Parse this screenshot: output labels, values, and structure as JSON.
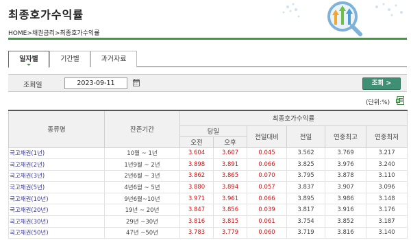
{
  "page": {
    "title": "최종호가수익률",
    "breadcrumb": [
      "HOME",
      "채권금리",
      "최종호가수익률"
    ]
  },
  "tabs": [
    {
      "label": "일자별",
      "active": true
    },
    {
      "label": "기간별",
      "active": false
    },
    {
      "label": "과거자료",
      "active": false
    }
  ],
  "search": {
    "label": "조회일",
    "date_value": "2023-09-11",
    "button_label": "조회 >"
  },
  "unit_label": "(단위:%)",
  "colors": {
    "accent_green": "#3e9a3e",
    "button_green": "#3e8f74",
    "negative_red": "#dd1111",
    "link_purple": "#3a3a9a"
  },
  "table": {
    "headers": {
      "name": "종류명",
      "maturity": "잔존기간",
      "group": "최종호가수익률",
      "today": "당일",
      "am": "오전",
      "pm": "오후",
      "change": "전일대비",
      "prev": "전일",
      "year_high": "연중최고",
      "year_low": "연중최저"
    },
    "rows": [
      {
        "name": "국고채권(1년)",
        "maturity": "10월 ~ 1년",
        "am": "3.604",
        "pm": "3.607",
        "change": "0.045",
        "prev": "3.562",
        "high": "3.769",
        "low": "3.217"
      },
      {
        "name": "국고채권(2년)",
        "maturity": "1년9월 ~ 2년",
        "am": "3.898",
        "pm": "3.891",
        "change": "0.066",
        "prev": "3.825",
        "high": "3.976",
        "low": "3.240"
      },
      {
        "name": "국고채권(3년)",
        "maturity": "2년6월 ~ 3년",
        "am": "3.862",
        "pm": "3.865",
        "change": "0.070",
        "prev": "3.795",
        "high": "3.878",
        "low": "3.110"
      },
      {
        "name": "국고채권(5년)",
        "maturity": "4년6월 ~ 5년",
        "am": "3.880",
        "pm": "3.894",
        "change": "0.057",
        "prev": "3.837",
        "high": "3.907",
        "low": "3.096"
      },
      {
        "name": "국고채권(10년)",
        "maturity": "9년6월~10년",
        "am": "3.971",
        "pm": "3.961",
        "change": "0.066",
        "prev": "3.895",
        "high": "3.986",
        "low": "3.148"
      },
      {
        "name": "국고채권(20년)",
        "maturity": "19년 ~ 20년",
        "am": "3.847",
        "pm": "3.856",
        "change": "0.039",
        "prev": "3.817",
        "high": "3.916",
        "low": "3.176"
      },
      {
        "name": "국고채권(30년)",
        "maturity": "29년 ~30년",
        "am": "3.816",
        "pm": "3.815",
        "change": "0.061",
        "prev": "3.754",
        "high": "3.852",
        "low": "3.187"
      },
      {
        "name": "국고채권(50년)",
        "maturity": "47년 ~50년",
        "am": "3.783",
        "pm": "3.779",
        "change": "0.060",
        "prev": "3.719",
        "high": "3.816",
        "low": "3.140"
      }
    ]
  }
}
